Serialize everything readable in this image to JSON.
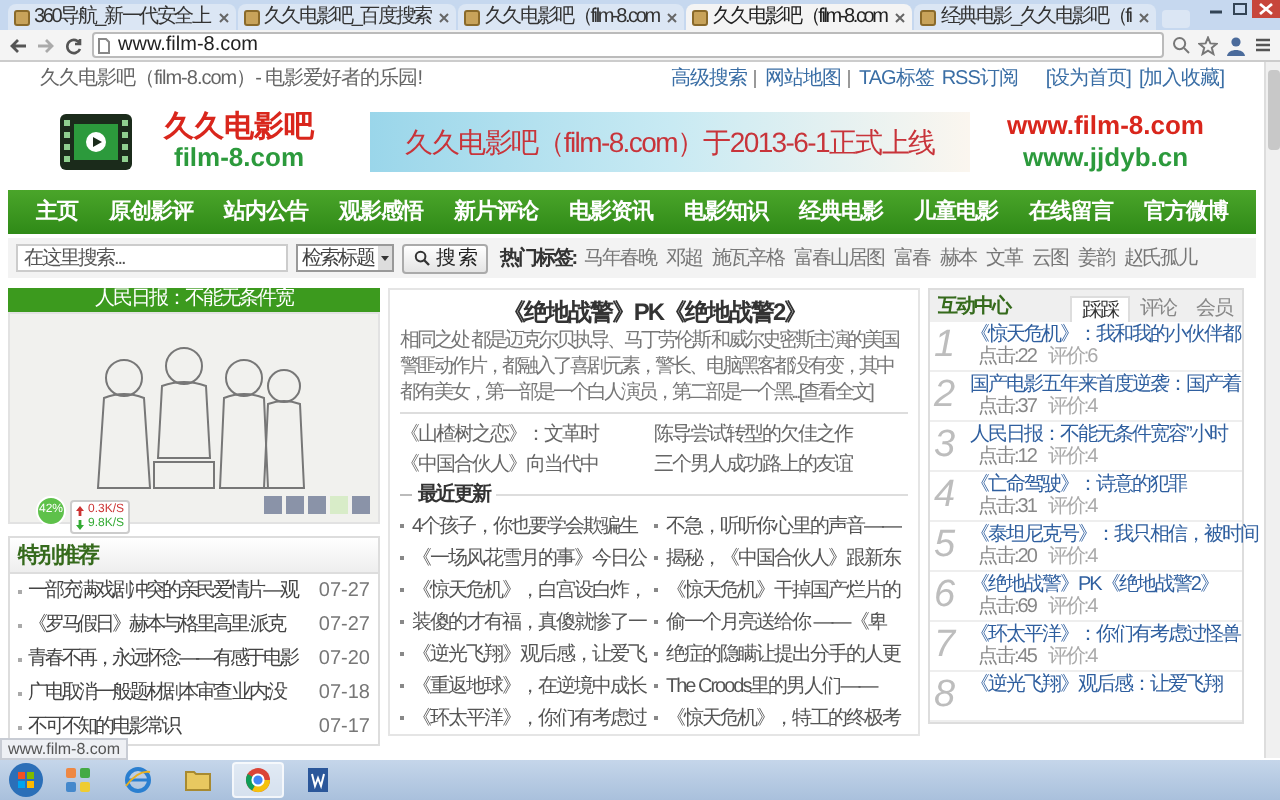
{
  "browser": {
    "tabs": [
      {
        "label": "360导航_新一代安全上",
        "selected": false
      },
      {
        "label": "久久电影吧_百度搜索",
        "selected": false
      },
      {
        "label": "久久电影吧（film-8.com",
        "selected": false
      },
      {
        "label": "久久电影吧（film-8.com",
        "selected": true
      },
      {
        "label": "经典电影_久久电影吧（fi",
        "selected": false
      }
    ],
    "address": "www.film-8.com"
  },
  "site_bar": {
    "slogan": "久久电影吧（film-8.com）- 电影爱好者的乐园!",
    "links": [
      "高级搜索",
      "网站地图",
      "TAG标签",
      "RSS订阅"
    ],
    "actions": [
      "[设为首页]",
      "[加入收藏]"
    ]
  },
  "header": {
    "logo_name": "久久电影吧",
    "logo_domain": "film-8.com",
    "banner": "久久电影吧（film-8.com）于2013-6-1正式上线",
    "url_primary": "www.film-8.com",
    "url_secondary": "www.jjdyb.cn"
  },
  "nav": [
    "主页",
    "原创影评",
    "站内公告",
    "观影感悟",
    "新片评论",
    "电影资讯",
    "电影知识",
    "经典电影",
    "儿童电影",
    "在线留言",
    "官方微博"
  ],
  "search": {
    "placeholder": "在这里搜索...",
    "scope": "检索标题",
    "button": "搜 索",
    "tags_label": "热门标签:",
    "tags": [
      "马年春晚",
      "邓超",
      "施瓦辛格",
      "富春山居图",
      "富春",
      "赫本",
      "文革",
      "云图",
      "姜韵",
      "赵氏孤儿"
    ]
  },
  "slideshow": {
    "caption": "人民日报：不能无条件宽",
    "slides": [
      {
        "selected": false
      },
      {
        "selected": false
      },
      {
        "selected": false
      },
      {
        "selected": true
      },
      {
        "selected": false
      }
    ]
  },
  "featured": {
    "title": "特别推荐",
    "items": [
      {
        "title": "一部充满戏剧冲突的亲民爱情片—观",
        "date": "07-27"
      },
      {
        "title": "《罗马假日》赫本与格里高里·派克",
        "date": "07-27"
      },
      {
        "title": "青春不再，永远怀念——有感于电影",
        "date": "07-20"
      },
      {
        "title": "广电取消一般题材剧本审查 业内:没",
        "date": "07-18"
      },
      {
        "title": "不可不知的电影常识",
        "date": "07-17"
      }
    ]
  },
  "article": {
    "title": "《绝地战警》PK《绝地战警2》",
    "summary": "相同之处 都是迈克尔贝执导、马丁劳伦斯 和威尔史密斯主演的美国警匪动作片，都融入了喜剧元素，警长、电脑黑客都没有变，其中都有美女，第一部是一个白人演员，第二部是一个黑...",
    "more": "[查看全文]",
    "links": [
      {
        "left": "《山楂树之恋》：文革时",
        "right": "陈导尝试转型的欠佳之作"
      },
      {
        "left": "《中国合伙人》向当代中",
        "right": "三个男人成功路上的友谊"
      }
    ],
    "recent_title": "最近更新",
    "recent": [
      {
        "left": "4个孩子，你也要学会欺骗生",
        "right": "不急，听听你心里的声音——"
      },
      {
        "left": "《一场风花雪月的事》今日公",
        "right": "揭秘，《中国合伙人》跟新东"
      },
      {
        "left": "《惊天危机》，白宫设白炸，",
        "right": "《惊天危机》干掉国产烂片的"
      },
      {
        "left": "装傻的才有福，真傻就惨了一",
        "right": "偷一个月亮送给你 ——《卑"
      },
      {
        "left": "《逆光飞翔》观后感，让爱飞",
        "right": "绝症的隐瞒让提出分手的人更"
      },
      {
        "left": "《重返地球》，在逆境中成长",
        "right": "The Croods里的男人们——"
      },
      {
        "left": "《环太平洋》，你们有考虑过",
        "right": "《惊天危机》，特工的终极考"
      }
    ]
  },
  "interaction": {
    "title": "互动中心",
    "tabs": [
      {
        "label": "踩踩",
        "selected": true
      },
      {
        "label": "评论",
        "selected": false
      },
      {
        "label": "会员",
        "selected": false
      }
    ],
    "items": [
      {
        "rank": "1",
        "title": "《惊天危机》：我和我的小伙伴都",
        "clicks": "点击:22",
        "rating": "评价:6"
      },
      {
        "rank": "2",
        "title": "国产电影五年来首度逆袭：国产着",
        "clicks": "点击:37",
        "rating": "评价:4"
      },
      {
        "rank": "3",
        "title": "人民日报：不能无条件宽容”小时",
        "clicks": "点击:12",
        "rating": "评价:4"
      },
      {
        "rank": "4",
        "title": "《亡命驾驶》：诗意的犯罪",
        "clicks": "点击:31",
        "rating": "评价:4"
      },
      {
        "rank": "5",
        "title": "《泰坦尼克号》：我只相信，被时间",
        "clicks": "点击:20",
        "rating": "评价:4"
      },
      {
        "rank": "6",
        "title": "《绝地战警》PK《绝地战警2》",
        "clicks": "点击:69",
        "rating": "评价:4"
      },
      {
        "rank": "7",
        "title": "《环太平洋》：你们有考虑过怪兽",
        "clicks": "点击:45",
        "rating": "评价:4"
      },
      {
        "rank": "8",
        "title": "《逆光飞翔》观后感：让爱飞翔"
      }
    ]
  },
  "speed_widget": {
    "percent": "42%",
    "upload": "0.3K/S",
    "download": "9.8K/S"
  },
  "status_bar": "www.film-8.com",
  "taskbar": {
    "apps": [
      {
        "kind": "squares",
        "selected": false
      },
      {
        "kind": "globe",
        "selected": false
      },
      {
        "kind": "folder",
        "selected": false
      },
      {
        "kind": "ring",
        "selected": true
      },
      {
        "kind": "document",
        "selected": false
      }
    ]
  }
}
